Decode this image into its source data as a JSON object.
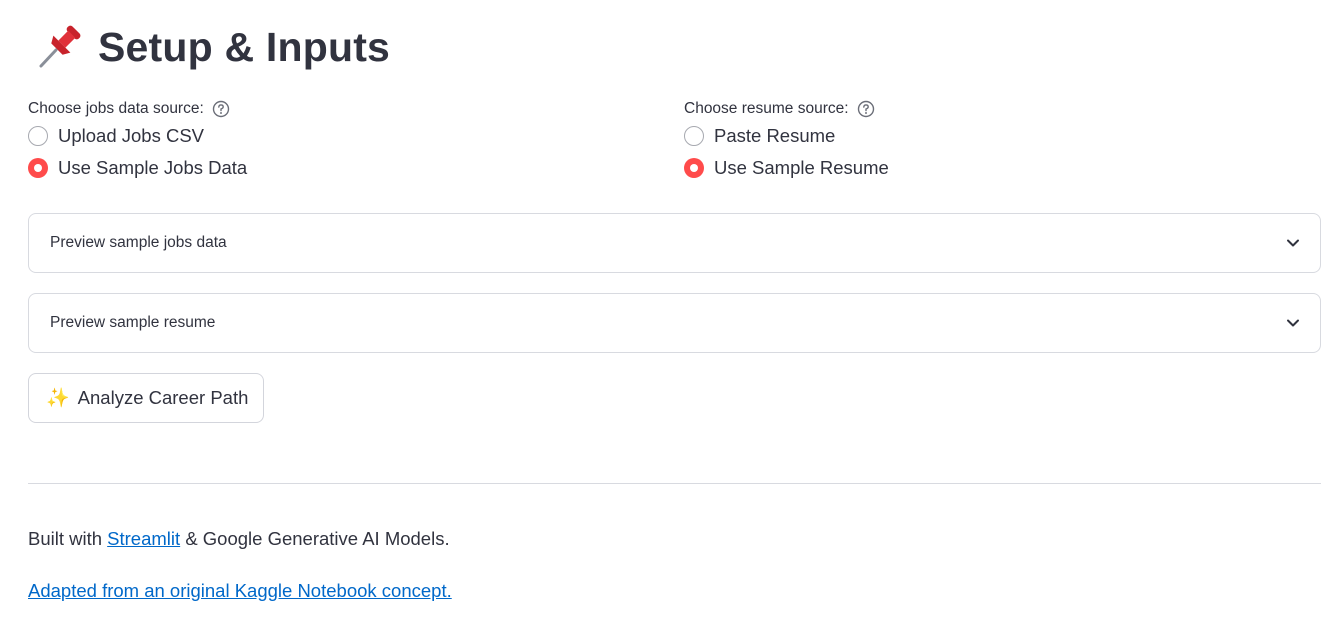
{
  "header": {
    "icon": "pushpin-icon",
    "title": "Setup & Inputs"
  },
  "jobs_source": {
    "label": "Choose jobs data source:",
    "help_icon": "help-circle-icon",
    "options": [
      {
        "label": "Upload Jobs CSV",
        "selected": false
      },
      {
        "label": "Use Sample Jobs Data",
        "selected": true
      }
    ]
  },
  "resume_source": {
    "label": "Choose resume source:",
    "help_icon": "help-circle-icon",
    "options": [
      {
        "label": "Paste Resume",
        "selected": false
      },
      {
        "label": "Use Sample Resume",
        "selected": true
      }
    ]
  },
  "expanders": [
    {
      "label": "Preview sample jobs data",
      "icon": "chevron-down-icon"
    },
    {
      "label": "Preview sample resume",
      "icon": "chevron-down-icon"
    }
  ],
  "analyze_button": {
    "icon": "sparkles-icon",
    "label": "Analyze Career Path"
  },
  "footer": {
    "built_prefix": "Built with",
    "streamlit_link": "Streamlit",
    "built_suffix": "& Google Generative AI Models.",
    "kaggle_link": "Adapted from an original Kaggle Notebook concept."
  },
  "colors": {
    "accent": "#ff4b4b",
    "link": "#0068c9",
    "text": "#31333f",
    "border": "#d8dae0"
  }
}
